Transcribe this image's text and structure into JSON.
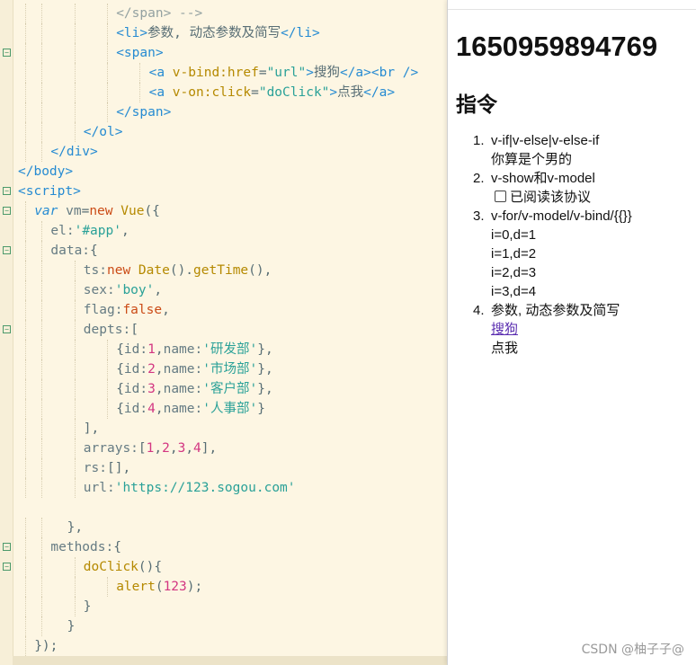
{
  "editor": {
    "lines": [
      {
        "fold": false,
        "indent": 6,
        "tokens": [
          {
            "c": "t-cmt",
            "v": "</span> -->"
          }
        ]
      },
      {
        "fold": false,
        "indent": 6,
        "tokens": [
          {
            "c": "t-tag",
            "v": "<li>"
          },
          {
            "c": "t-plain",
            "v": "参数, 动态参数及简写"
          },
          {
            "c": "t-tag",
            "v": "</li>"
          }
        ]
      },
      {
        "fold": true,
        "indent": 6,
        "tokens": [
          {
            "c": "t-tag",
            "v": "<span>"
          }
        ]
      },
      {
        "fold": false,
        "indent": 8,
        "tokens": [
          {
            "c": "t-tag",
            "v": "<a "
          },
          {
            "c": "t-attr",
            "v": "v-bind:href"
          },
          {
            "c": "t-plain",
            "v": "="
          },
          {
            "c": "t-str",
            "v": "\"url\""
          },
          {
            "c": "t-tag",
            "v": ">"
          },
          {
            "c": "t-plain",
            "v": "搜狗"
          },
          {
            "c": "t-tag",
            "v": "</a><br />"
          }
        ]
      },
      {
        "fold": false,
        "indent": 8,
        "tokens": [
          {
            "c": "t-tag",
            "v": "<a "
          },
          {
            "c": "t-attr",
            "v": "v-on:click"
          },
          {
            "c": "t-plain",
            "v": "="
          },
          {
            "c": "t-str",
            "v": "\"doClick\""
          },
          {
            "c": "t-tag",
            "v": ">"
          },
          {
            "c": "t-plain",
            "v": "点我"
          },
          {
            "c": "t-tag",
            "v": "</a>"
          }
        ]
      },
      {
        "fold": false,
        "indent": 6,
        "tokens": [
          {
            "c": "t-tag",
            "v": "</span>"
          }
        ]
      },
      {
        "fold": false,
        "indent": 4,
        "tokens": [
          {
            "c": "t-tag",
            "v": "</ol>"
          }
        ]
      },
      {
        "fold": false,
        "indent": 2,
        "tokens": [
          {
            "c": "t-tag",
            "v": "</div>"
          }
        ]
      },
      {
        "fold": false,
        "indent": 0,
        "tokens": [
          {
            "c": "t-tag",
            "v": "</body>"
          }
        ]
      },
      {
        "fold": true,
        "indent": 0,
        "tokens": [
          {
            "c": "t-tag",
            "v": "<script>"
          }
        ]
      },
      {
        "fold": true,
        "indent": 1,
        "tokens": [
          {
            "c": "t-key",
            "v": "var "
          },
          {
            "c": "t-prop",
            "v": "vm"
          },
          {
            "c": "t-plain",
            "v": "="
          },
          {
            "c": "t-kw",
            "v": "new "
          },
          {
            "c": "t-fn",
            "v": "Vue"
          },
          {
            "c": "t-plain",
            "v": "({"
          }
        ]
      },
      {
        "fold": false,
        "indent": 2,
        "tokens": [
          {
            "c": "t-prop",
            "v": "el:"
          },
          {
            "c": "t-str",
            "v": "'#app'"
          },
          {
            "c": "t-plain",
            "v": ","
          }
        ]
      },
      {
        "fold": true,
        "indent": 2,
        "tokens": [
          {
            "c": "t-prop",
            "v": "data:"
          },
          {
            "c": "t-plain",
            "v": "{"
          }
        ]
      },
      {
        "fold": false,
        "indent": 4,
        "tokens": [
          {
            "c": "t-prop",
            "v": "ts:"
          },
          {
            "c": "t-kw",
            "v": "new "
          },
          {
            "c": "t-fn",
            "v": "Date"
          },
          {
            "c": "t-plain",
            "v": "()."
          },
          {
            "c": "t-fn",
            "v": "getTime"
          },
          {
            "c": "t-plain",
            "v": "(),"
          }
        ]
      },
      {
        "fold": false,
        "indent": 4,
        "tokens": [
          {
            "c": "t-prop",
            "v": "sex:"
          },
          {
            "c": "t-str",
            "v": "'boy'"
          },
          {
            "c": "t-plain",
            "v": ","
          }
        ]
      },
      {
        "fold": false,
        "indent": 4,
        "tokens": [
          {
            "c": "t-prop",
            "v": "flag:"
          },
          {
            "c": "t-kw",
            "v": "false"
          },
          {
            "c": "t-plain",
            "v": ","
          }
        ]
      },
      {
        "fold": true,
        "indent": 4,
        "tokens": [
          {
            "c": "t-prop",
            "v": "depts:"
          },
          {
            "c": "t-plain",
            "v": "["
          }
        ]
      },
      {
        "fold": false,
        "indent": 6,
        "tokens": [
          {
            "c": "t-plain",
            "v": "{"
          },
          {
            "c": "t-prop",
            "v": "id:"
          },
          {
            "c": "t-num",
            "v": "1"
          },
          {
            "c": "t-plain",
            "v": ","
          },
          {
            "c": "t-prop",
            "v": "name:"
          },
          {
            "c": "t-str",
            "v": "'研发部'"
          },
          {
            "c": "t-plain",
            "v": "},"
          }
        ]
      },
      {
        "fold": false,
        "indent": 6,
        "tokens": [
          {
            "c": "t-plain",
            "v": "{"
          },
          {
            "c": "t-prop",
            "v": "id:"
          },
          {
            "c": "t-num",
            "v": "2"
          },
          {
            "c": "t-plain",
            "v": ","
          },
          {
            "c": "t-prop",
            "v": "name:"
          },
          {
            "c": "t-str",
            "v": "'市场部'"
          },
          {
            "c": "t-plain",
            "v": "},"
          }
        ]
      },
      {
        "fold": false,
        "indent": 6,
        "tokens": [
          {
            "c": "t-plain",
            "v": "{"
          },
          {
            "c": "t-prop",
            "v": "id:"
          },
          {
            "c": "t-num",
            "v": "3"
          },
          {
            "c": "t-plain",
            "v": ","
          },
          {
            "c": "t-prop",
            "v": "name:"
          },
          {
            "c": "t-str",
            "v": "'客户部'"
          },
          {
            "c": "t-plain",
            "v": "},"
          }
        ]
      },
      {
        "fold": false,
        "indent": 6,
        "tokens": [
          {
            "c": "t-plain",
            "v": "{"
          },
          {
            "c": "t-prop",
            "v": "id:"
          },
          {
            "c": "t-num",
            "v": "4"
          },
          {
            "c": "t-plain",
            "v": ","
          },
          {
            "c": "t-prop",
            "v": "name:"
          },
          {
            "c": "t-str",
            "v": "'人事部'"
          },
          {
            "c": "t-plain",
            "v": "}"
          }
        ]
      },
      {
        "fold": false,
        "indent": 4,
        "tokens": [
          {
            "c": "t-plain",
            "v": "],"
          }
        ]
      },
      {
        "fold": false,
        "indent": 4,
        "tokens": [
          {
            "c": "t-prop",
            "v": "arrays:"
          },
          {
            "c": "t-plain",
            "v": "["
          },
          {
            "c": "t-num",
            "v": "1"
          },
          {
            "c": "t-plain",
            "v": ","
          },
          {
            "c": "t-num",
            "v": "2"
          },
          {
            "c": "t-plain",
            "v": ","
          },
          {
            "c": "t-num",
            "v": "3"
          },
          {
            "c": "t-plain",
            "v": ","
          },
          {
            "c": "t-num",
            "v": "4"
          },
          {
            "c": "t-plain",
            "v": "],"
          }
        ]
      },
      {
        "fold": false,
        "indent": 4,
        "tokens": [
          {
            "c": "t-prop",
            "v": "rs:"
          },
          {
            "c": "t-plain",
            "v": "[],"
          }
        ]
      },
      {
        "fold": false,
        "indent": 4,
        "tokens": [
          {
            "c": "t-prop",
            "v": "url:"
          },
          {
            "c": "t-str",
            "v": "'https://123.sogou.com'"
          }
        ]
      },
      {
        "fold": false,
        "indent": 0,
        "tokens": []
      },
      {
        "fold": false,
        "indent": 3,
        "tokens": [
          {
            "c": "t-plain",
            "v": "},"
          }
        ]
      },
      {
        "fold": true,
        "indent": 2,
        "tokens": [
          {
            "c": "t-prop",
            "v": "methods:"
          },
          {
            "c": "t-plain",
            "v": "{"
          }
        ]
      },
      {
        "fold": true,
        "indent": 4,
        "tokens": [
          {
            "c": "t-fn",
            "v": "doClick"
          },
          {
            "c": "t-plain",
            "v": "(){"
          }
        ]
      },
      {
        "fold": false,
        "indent": 6,
        "tokens": [
          {
            "c": "t-fn",
            "v": "alert"
          },
          {
            "c": "t-plain",
            "v": "("
          },
          {
            "c": "t-num",
            "v": "123"
          },
          {
            "c": "t-plain",
            "v": ");"
          }
        ]
      },
      {
        "fold": false,
        "indent": 4,
        "tokens": [
          {
            "c": "t-plain",
            "v": "}"
          }
        ]
      },
      {
        "fold": false,
        "indent": 3,
        "tokens": [
          {
            "c": "t-plain",
            "v": "}"
          }
        ]
      },
      {
        "fold": false,
        "indent": 1,
        "tokens": [
          {
            "c": "t-plain",
            "v": "});"
          }
        ]
      }
    ]
  },
  "preview": {
    "timestamp": "1650959894769",
    "heading": "指令",
    "items": [
      {
        "num": "1.",
        "label": "v-if|v-else|v-else-if",
        "sub": "你算是个男的"
      },
      {
        "num": "2.",
        "label": "v-show和v-model",
        "checkbox_label": "已阅读该协议"
      },
      {
        "num": "3.",
        "label": "v-for/v-model/v-bind/{{}}",
        "rows": [
          "i=0,d=1",
          "i=1,d=2",
          "i=2,d=3",
          "i=3,d=4"
        ]
      },
      {
        "num": "4.",
        "label": "参数, 动态参数及简写",
        "link_text": "搜狗",
        "click_text": "点我"
      }
    ],
    "watermark": "CSDN @柚子子@"
  }
}
